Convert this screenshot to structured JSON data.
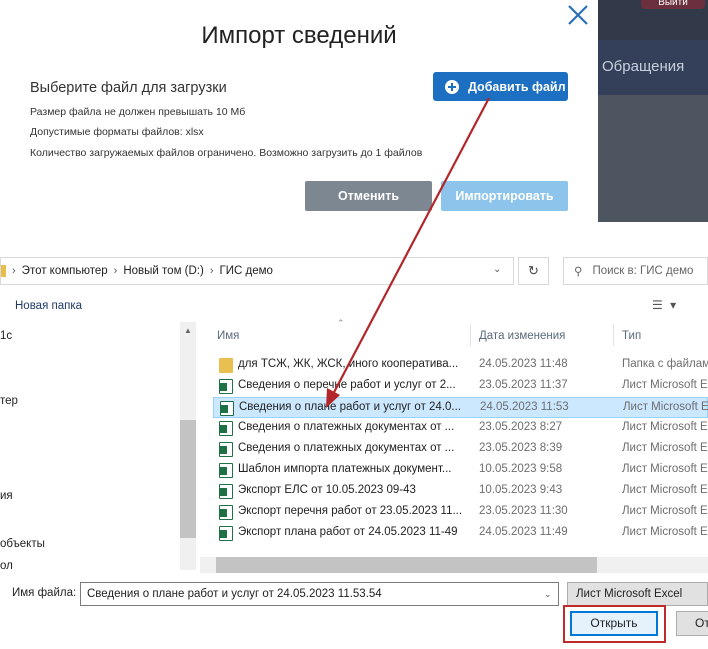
{
  "background": {
    "exit_label": "Выйти",
    "nav_item": "Обращения"
  },
  "modal": {
    "title": "Импорт сведений",
    "subtitle": "Выберите файл для загрузки",
    "notes": [
      "Размер файла не должен превышать 10 Мб",
      "Допустимые форматы файлов: xlsx",
      "Количество загружаемых файлов ограничено. Возможно загрузить до 1 файлов"
    ],
    "add_file_label": "Добавить файл",
    "cancel_label": "Отменить",
    "import_label": "Импортировать"
  },
  "dialog": {
    "breadcrumb": [
      "Этот компьютер",
      "Новый том (D:)",
      "ГИС демо"
    ],
    "search_placeholder": "Поиск в: ГИС демо",
    "new_folder_label": "Новая папка",
    "nav_items": [
      "1с",
      "тер",
      "ия",
      "объекты",
      "ол"
    ],
    "columns": [
      "Имя",
      "Дата изменения",
      "Тип"
    ],
    "files": [
      {
        "name": "для ТСЖ, ЖК, ЖСК, иного кооператива...",
        "date": "24.05.2023 11:48",
        "type": "Папка с файлами",
        "icon": "folder-icon",
        "selected": false
      },
      {
        "name": "Сведения о перечне работ и услуг от 2...",
        "date": "23.05.2023 11:37",
        "type": "Лист Microsoft Excel",
        "icon": "excel-file-icon",
        "selected": false
      },
      {
        "name": "Сведения о плане работ и услуг от 24.0...",
        "date": "24.05.2023 11:53",
        "type": "Лист Microsoft Excel",
        "icon": "excel-file-icon",
        "selected": true
      },
      {
        "name": "Сведения о платежных документах от ...",
        "date": "23.05.2023 8:27",
        "type": "Лист Microsoft Excel",
        "icon": "excel-file-icon",
        "selected": false
      },
      {
        "name": "Сведения о платежных документах от ...",
        "date": "23.05.2023 8:39",
        "type": "Лист Microsoft Excel",
        "icon": "excel-file-icon",
        "selected": false
      },
      {
        "name": "Шаблон импорта платежных документ...",
        "date": "10.05.2023 9:58",
        "type": "Лист Microsoft Excel",
        "icon": "excel-file-icon",
        "selected": false
      },
      {
        "name": "Экспорт ЕЛС от 10.05.2023 09-43",
        "date": "10.05.2023 9:43",
        "type": "Лист Microsoft Excel",
        "icon": "excel-file-icon",
        "selected": false
      },
      {
        "name": "Экспорт перечня работ от 23.05.2023 11...",
        "date": "23.05.2023 11:30",
        "type": "Лист Microsoft Excel",
        "icon": "excel-file-icon",
        "selected": false
      },
      {
        "name": "Экспорт плана работ от 24.05.2023 11-49",
        "date": "24.05.2023 11:49",
        "type": "Лист Microsoft Excel",
        "icon": "excel-file-icon",
        "selected": false
      }
    ],
    "filename_label": "Имя файла:",
    "filename_value": "Сведения о плане работ и услуг от 24.05.2023 11.53.54",
    "filetype_value": "Лист Microsoft Excel",
    "open_label": "Открыть",
    "cancel_label": "Отмена"
  },
  "colors": {
    "primary_button": "#1d6fc2",
    "annotation_red": "#c0292a",
    "selection": "#cce8ff"
  }
}
